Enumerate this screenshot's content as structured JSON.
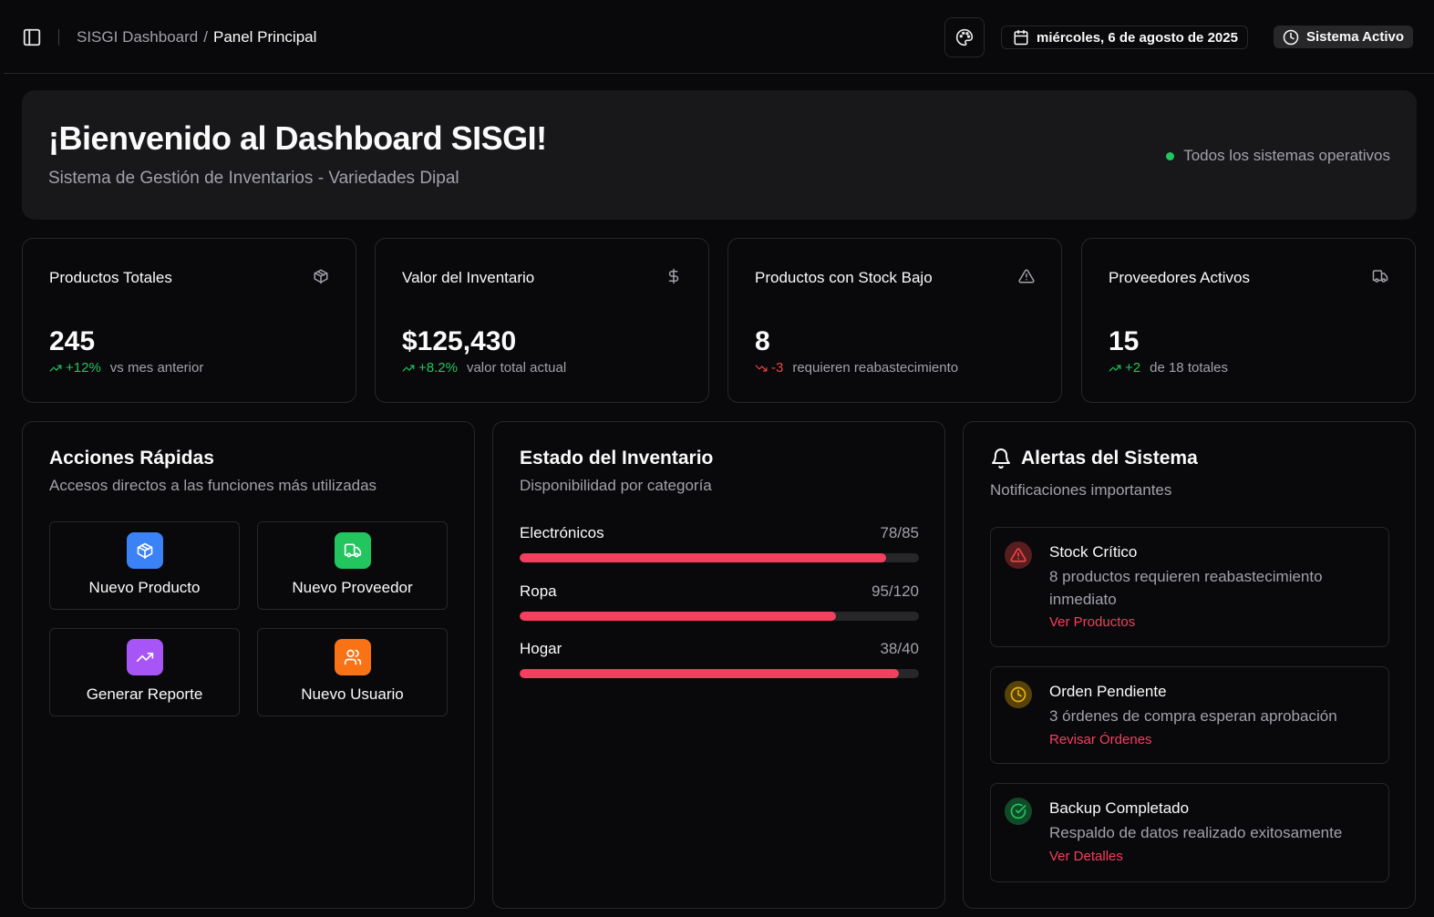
{
  "header": {
    "breadcrumb_root": "SISGI Dashboard",
    "breadcrumb_sep": "/",
    "breadcrumb_current": "Panel Principal",
    "date": "miércoles, 6 de agosto de 2025",
    "status": "Sistema Activo"
  },
  "welcome": {
    "title": "¡Bienvenido al Dashboard SISGI!",
    "subtitle": "Sistema de Gestión de Inventarios - Variedades Dipal",
    "status": "Todos los sistemas operativos"
  },
  "stats": [
    {
      "title": "Productos Totales",
      "value": "245",
      "trend": "+12%",
      "trend_dir": "up",
      "note": "vs mes anterior",
      "icon": "box-icon"
    },
    {
      "title": "Valor del Inventario",
      "value": "$125,430",
      "trend": "+8.2%",
      "trend_dir": "up",
      "note": "valor total actual",
      "icon": "dollar-icon"
    },
    {
      "title": "Productos con Stock Bajo",
      "value": "8",
      "trend": "-3",
      "trend_dir": "down",
      "note": "requieren reabastecimiento",
      "icon": "alert-triangle-icon"
    },
    {
      "title": "Proveedores Activos",
      "value": "15",
      "trend": "+2",
      "trend_dir": "up",
      "note": "de 18 totales",
      "icon": "truck-icon"
    }
  ],
  "quick_actions": {
    "title": "Acciones Rápidas",
    "subtitle": "Accesos directos a las funciones más utilizadas",
    "items": [
      {
        "label": "Nuevo Producto",
        "icon": "box-icon",
        "color": "#3b82f6"
      },
      {
        "label": "Nuevo Proveedor",
        "icon": "truck-icon",
        "color": "#22c55e"
      },
      {
        "label": "Generar Reporte",
        "icon": "trending-up-icon",
        "color": "#a855f7"
      },
      {
        "label": "Nuevo Usuario",
        "icon": "users-icon",
        "color": "#f97316"
      }
    ]
  },
  "inventory": {
    "title": "Estado del Inventario",
    "subtitle": "Disponibilidad por categoría",
    "accent": "#f43f5e",
    "items": [
      {
        "name": "Electrónicos",
        "count": "78/85",
        "current": 78,
        "total": 85
      },
      {
        "name": "Ropa",
        "count": "95/120",
        "current": 95,
        "total": 120
      },
      {
        "name": "Hogar",
        "count": "38/40",
        "current": 38,
        "total": 40
      }
    ]
  },
  "alerts": {
    "title": "Alertas del Sistema",
    "subtitle": "Notificaciones importantes",
    "items": [
      {
        "title": "Stock Crítico",
        "desc": "8 productos requieren reabastecimiento inmediato",
        "link": "Ver Productos",
        "icon": "alert-triangle-icon",
        "color": "#ef4444"
      },
      {
        "title": "Orden Pendiente",
        "desc": "3 órdenes de compra esperan aprobación",
        "link": "Revisar Órdenes",
        "icon": "clock-icon",
        "color": "#eab308"
      },
      {
        "title": "Backup Completado",
        "desc": "Respaldo de datos realizado exitosamente",
        "link": "Ver Detalles",
        "icon": "check-circle-icon",
        "color": "#22c55e"
      }
    ]
  }
}
